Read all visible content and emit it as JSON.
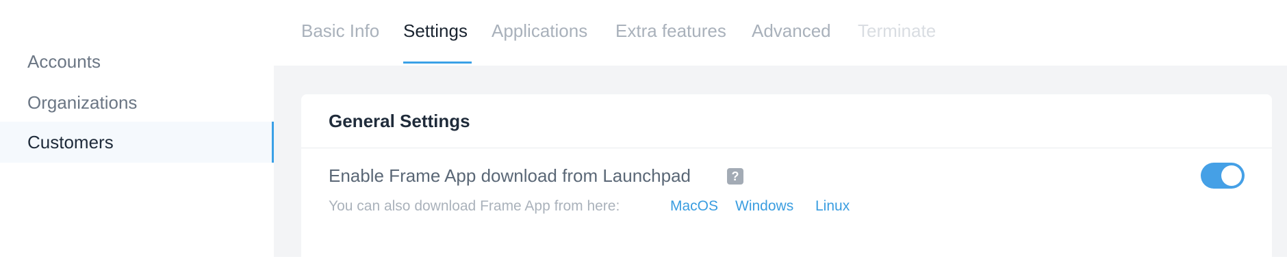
{
  "sidebar": {
    "items": [
      {
        "label": "Accounts",
        "active": false
      },
      {
        "label": "Organizations",
        "active": false
      },
      {
        "label": "Customers",
        "active": true
      }
    ]
  },
  "tabs": [
    {
      "label": "Basic Info",
      "state": "inactive"
    },
    {
      "label": "Settings",
      "state": "active"
    },
    {
      "label": "Applications",
      "state": "inactive"
    },
    {
      "label": "Extra features",
      "state": "inactive"
    },
    {
      "label": "Advanced",
      "state": "inactive"
    },
    {
      "label": "Terminate",
      "state": "disabled"
    }
  ],
  "card": {
    "title": "General Settings",
    "setting": {
      "label": "Enable Frame App download from Launchpad",
      "help_icon": "?",
      "description": "You can also download Frame App from here:",
      "links": [
        "MacOS",
        "Windows",
        "Linux"
      ],
      "enabled": true
    }
  },
  "colors": {
    "accent": "#3aa0e6",
    "link": "#3a9de0",
    "toggle_on": "#45a0e6"
  }
}
